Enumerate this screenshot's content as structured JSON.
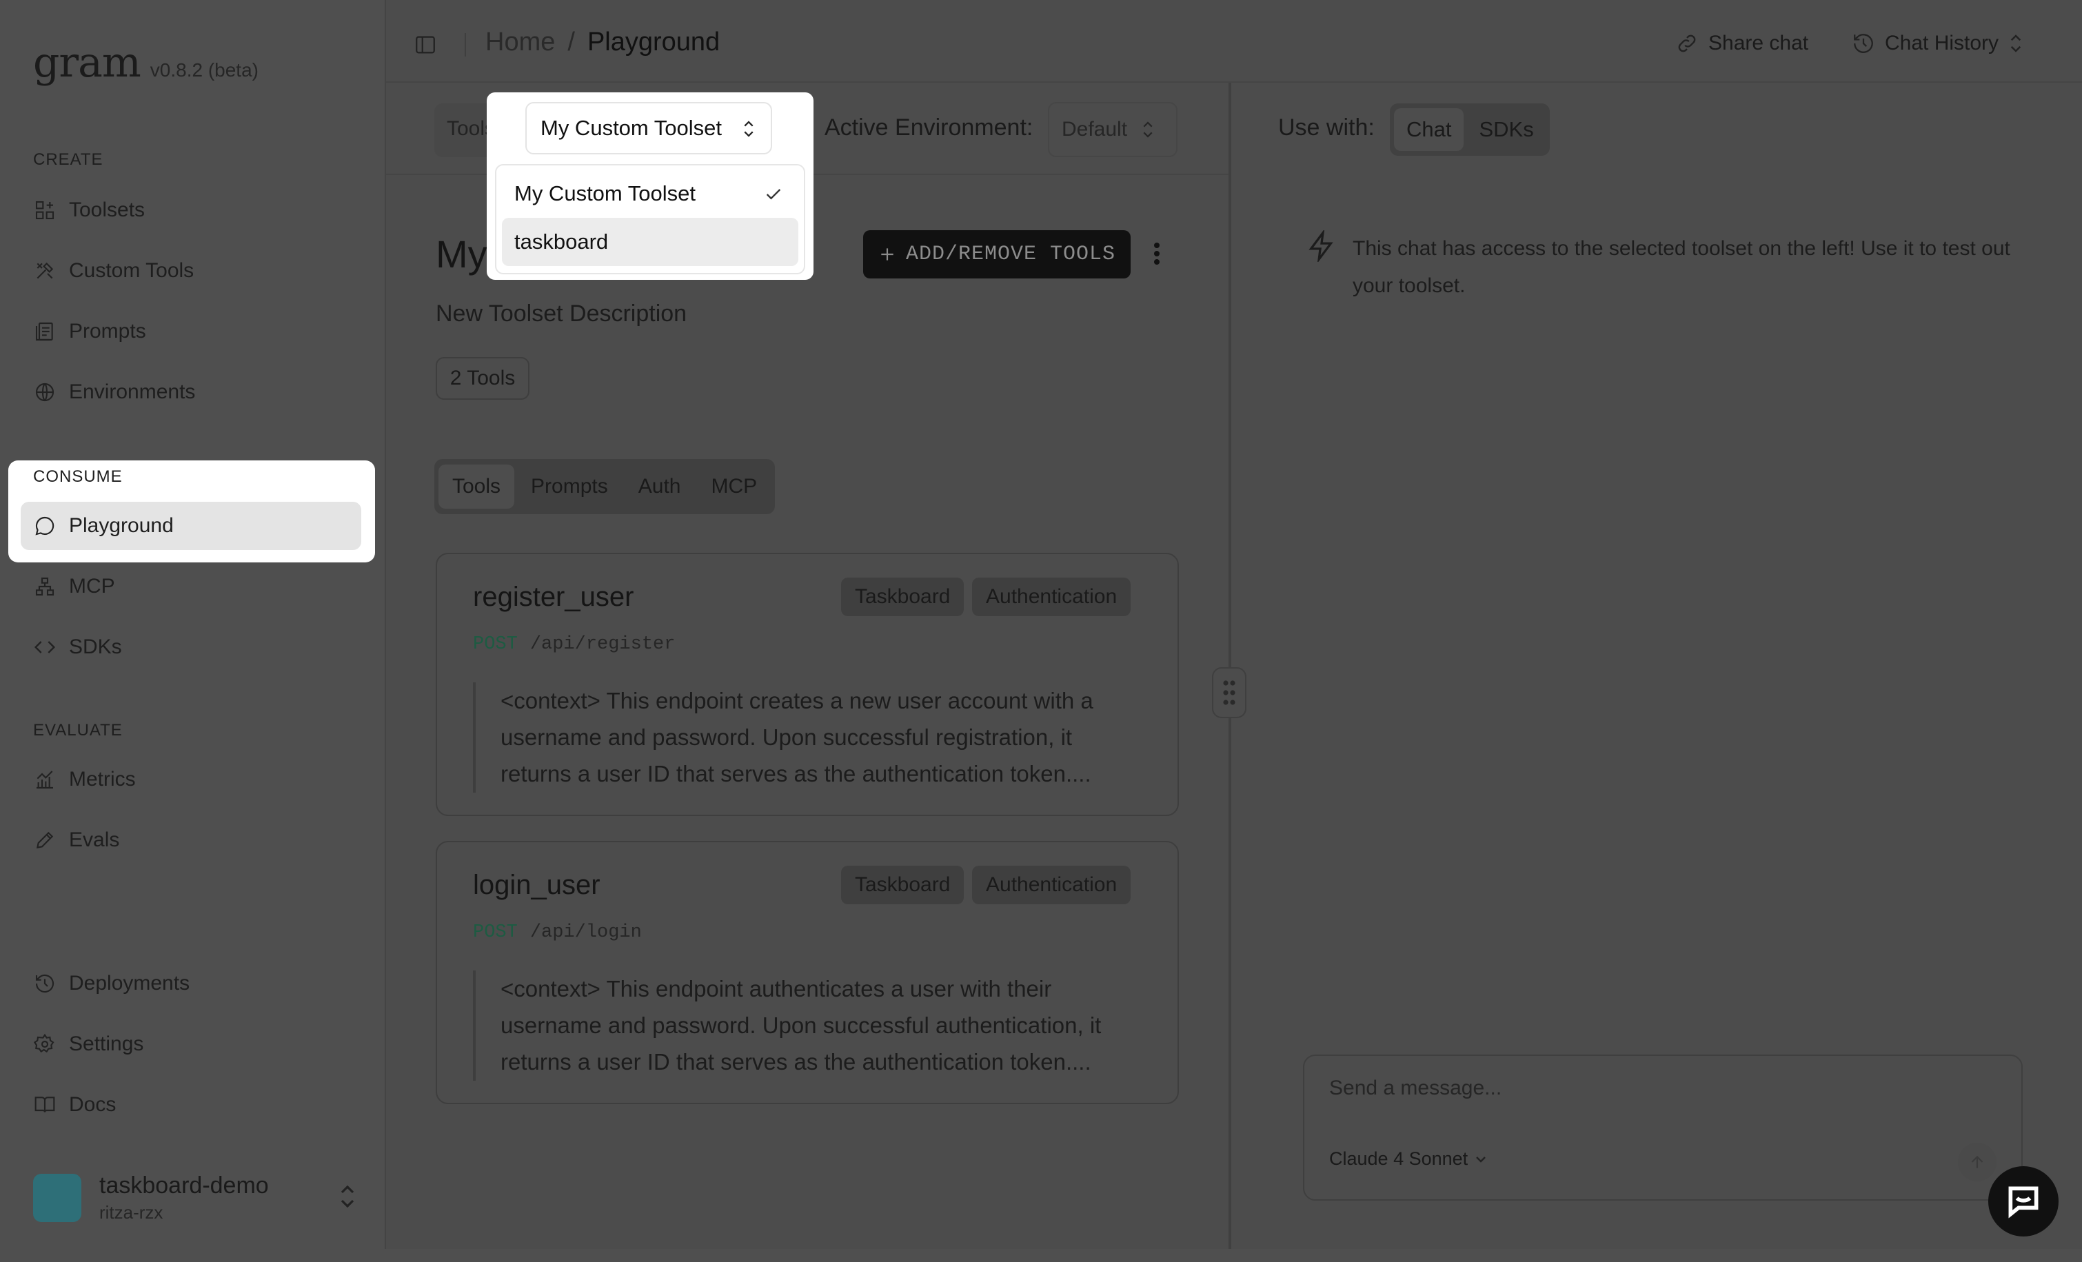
{
  "app": {
    "logo": "gram",
    "version": "v0.8.2 (beta)"
  },
  "sidebar": {
    "sections": {
      "create": "CREATE",
      "consume": "CONSUME",
      "evaluate": "EVALUATE"
    },
    "create_items": [
      {
        "label": "Toolsets",
        "icon": "toolsets-icon"
      },
      {
        "label": "Custom Tools",
        "icon": "custom-tools-icon"
      },
      {
        "label": "Prompts",
        "icon": "prompts-icon"
      },
      {
        "label": "Environments",
        "icon": "globe-icon"
      }
    ],
    "consume_items": [
      {
        "label": "Playground",
        "icon": "chat-bubble-icon",
        "active": true
      },
      {
        "label": "MCP",
        "icon": "network-icon"
      },
      {
        "label": "SDKs",
        "icon": "code-icon"
      }
    ],
    "evaluate_items": [
      {
        "label": "Metrics",
        "icon": "chart-icon"
      },
      {
        "label": "Evals",
        "icon": "pencil-icon"
      }
    ],
    "bottom_items": [
      {
        "label": "Deployments",
        "icon": "history-icon"
      },
      {
        "label": "Settings",
        "icon": "gear-icon"
      },
      {
        "label": "Docs",
        "icon": "book-icon"
      }
    ],
    "project": {
      "name": "taskboard-demo",
      "org": "ritza-rzx",
      "avatar_color": "#2e6f78"
    }
  },
  "header": {
    "breadcrumb": {
      "home": "Home",
      "separator": "/",
      "current": "Playground"
    },
    "share_label": "Share chat",
    "history_label": "Chat History"
  },
  "toolbar": {
    "toolset_label": "Toolset",
    "toolset_selected": "My Custom Toolset",
    "toolset_options": [
      {
        "label": "My Custom Toolset",
        "selected": true
      },
      {
        "label": "taskboard",
        "selected": false
      }
    ],
    "environment_label": "Active Environment:",
    "environment_value": "Default"
  },
  "toolset": {
    "title_visible": "My",
    "add_button": "ADD/REMOVE TOOLS",
    "description": "New Toolset Description",
    "tool_count": "2 Tools",
    "tabs": [
      "Tools",
      "Prompts",
      "Auth",
      "MCP"
    ],
    "active_tab": "Tools",
    "tools": [
      {
        "name": "register_user",
        "tags": [
          "Taskboard",
          "Authentication"
        ],
        "method": "POST",
        "path": "/api/register",
        "description": "<context> This endpoint creates a new user account with a username and password. Upon successful registration, it returns a user ID that serves as the authentication token...."
      },
      {
        "name": "login_user",
        "tags": [
          "Taskboard",
          "Authentication"
        ],
        "method": "POST",
        "path": "/api/login",
        "description": "<context> This endpoint authenticates a user with their username and password. Upon successful authentication, it returns a user ID that serves as the authentication token...."
      }
    ]
  },
  "chat": {
    "use_with_label": "Use with:",
    "use_with_tabs": [
      "Chat",
      "SDKs"
    ],
    "active_use_with": "Chat",
    "notice": "This chat has access to the selected toolset on the left! Use it to test out your toolset.",
    "input_placeholder": "Send a message...",
    "model": "Claude 4 Sonnet"
  },
  "colors": {
    "accent_method": "#1d5b42",
    "button_dark": "#111111",
    "highlight": "#ffffff"
  }
}
